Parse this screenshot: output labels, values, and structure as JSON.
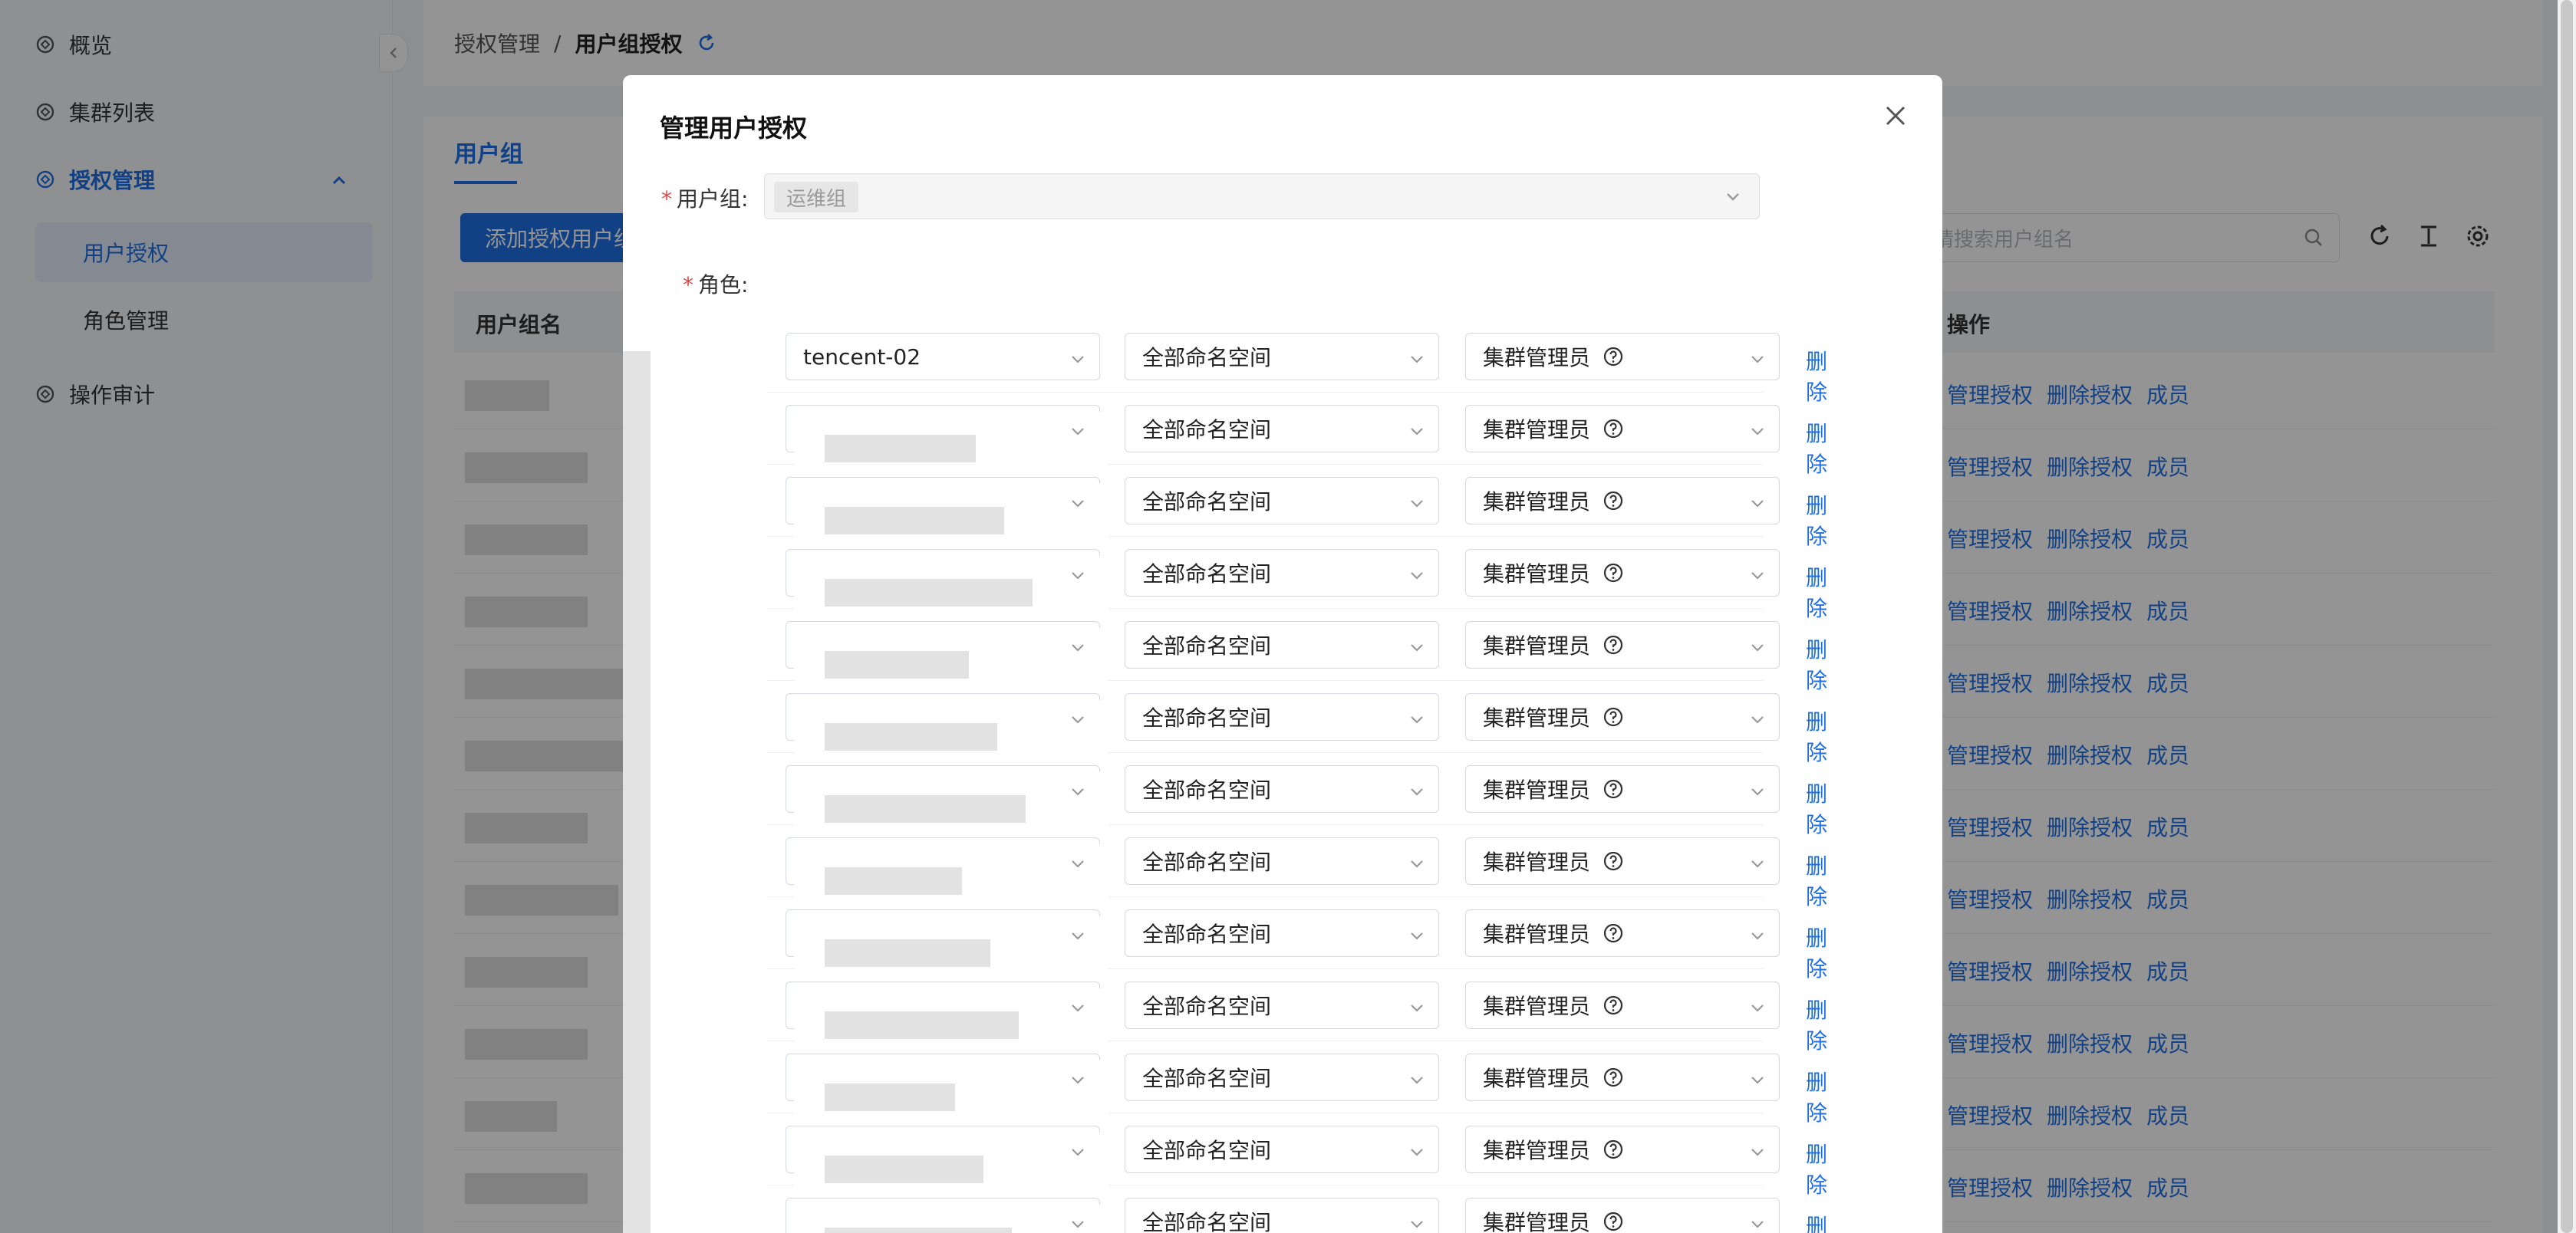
{
  "sidebar": {
    "items": [
      {
        "label": "概览"
      },
      {
        "label": "集群列表"
      },
      {
        "label": "授权管理"
      },
      {
        "label": "操作审计"
      }
    ],
    "sub_items": [
      {
        "label": "用户授权"
      },
      {
        "label": "角色管理"
      }
    ]
  },
  "breadcrumb": {
    "parent": "授权管理",
    "separator": "/",
    "current": "用户组授权"
  },
  "tabs": {
    "user_group": "用户组"
  },
  "toolbar": {
    "add_button": "添加授权用户组",
    "search_placeholder": "请搜索用户组名"
  },
  "table": {
    "col_name": "用户组名",
    "col_ops": "操作",
    "row_actions": [
      "管理授权",
      "删除授权",
      "成员"
    ]
  },
  "modal": {
    "title": "管理用户授权",
    "usergroup_label": "用户组:",
    "usergroup_value": "运维组",
    "role_label": "角色:",
    "first_cluster": "tencent-02",
    "namespace_value": "全部命名空间",
    "role_value": "集群管理员",
    "delete_label": "删除"
  },
  "colors": {
    "accent": "#1f6fe5",
    "required": "#e54545"
  }
}
